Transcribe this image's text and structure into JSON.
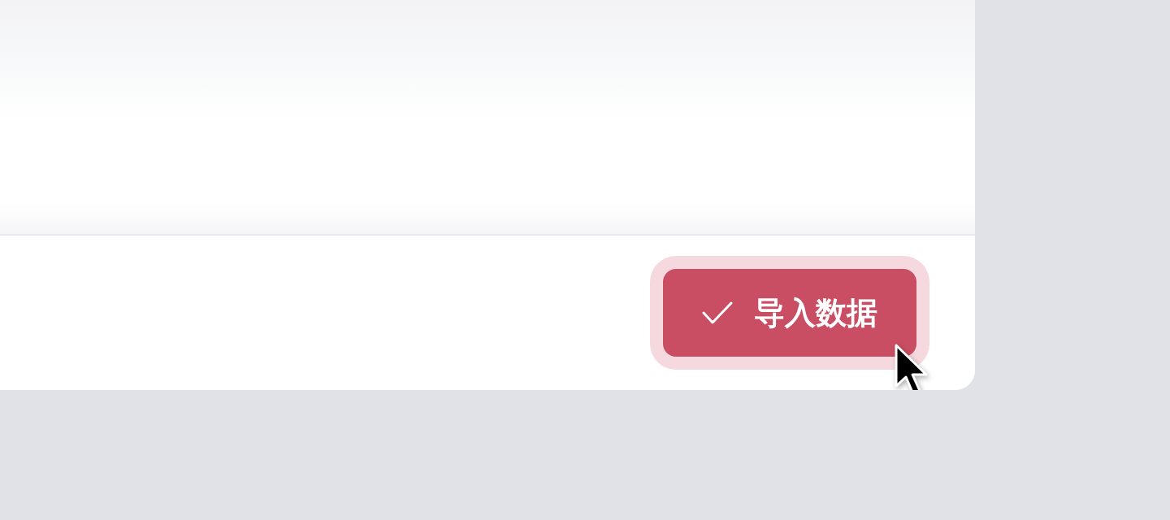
{
  "dialog": {
    "footer": {
      "primary_button": {
        "label": "导入数据",
        "focused": true
      }
    }
  }
}
